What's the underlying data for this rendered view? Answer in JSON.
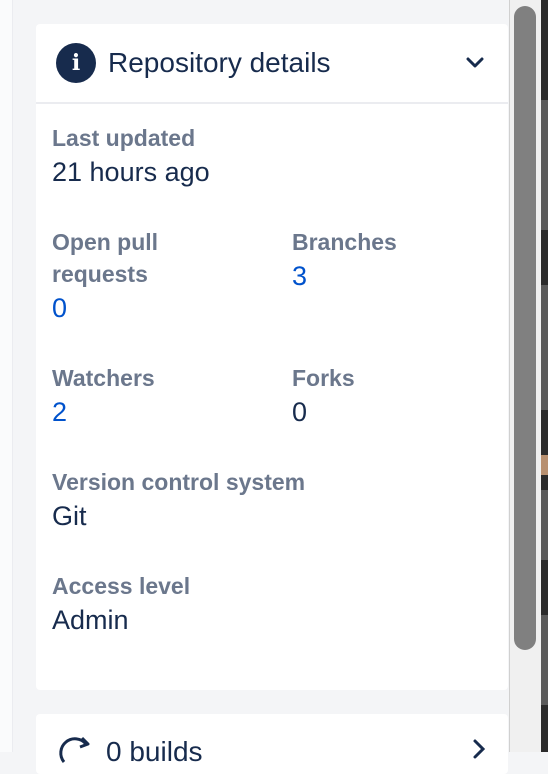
{
  "details": {
    "title": "Repository details",
    "last_updated": {
      "label": "Last updated",
      "value": "21 hours ago"
    },
    "open_pull_requests": {
      "label_line1": "Open pull",
      "label_line2": "requests",
      "value": "0"
    },
    "branches": {
      "label": "Branches",
      "value": "3"
    },
    "watchers": {
      "label": "Watchers",
      "value": "2"
    },
    "forks": {
      "label": "Forks",
      "value": "0"
    },
    "vcs": {
      "label": "Version control system",
      "value": "Git"
    },
    "access": {
      "label": "Access level",
      "value": "Admin"
    }
  },
  "builds": {
    "label": "0 builds"
  },
  "icons": {
    "info": "info-icon",
    "chevron": "chevron-down-icon",
    "builds": "refresh-icon",
    "builds_chevron": "chevron-right-icon"
  },
  "colors": {
    "link": "#0052cc",
    "text": "#172b4d",
    "label": "#6b778c",
    "background": "#f4f5f7"
  }
}
